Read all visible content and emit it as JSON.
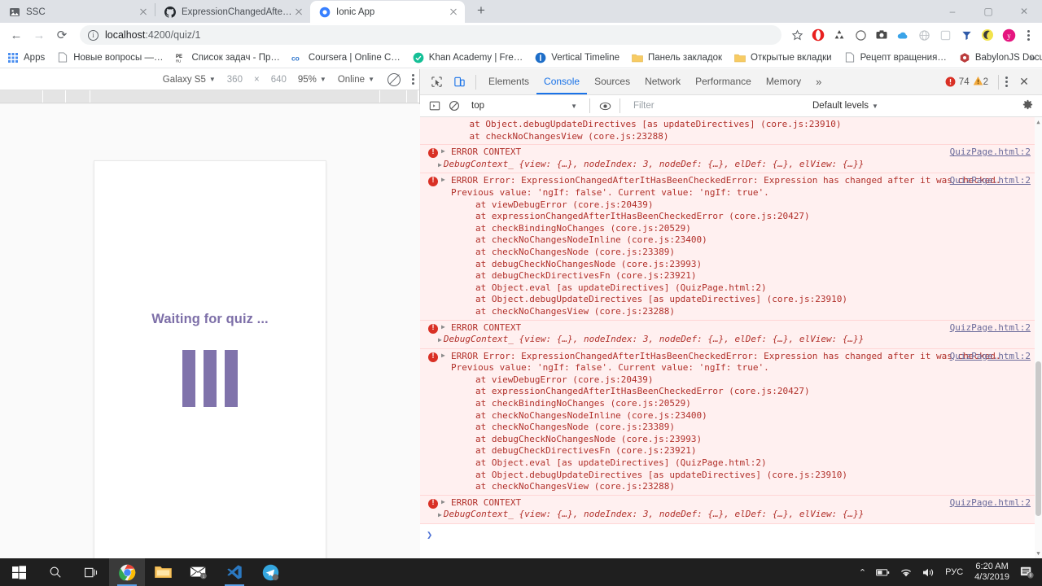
{
  "browser": {
    "tabs": [
      {
        "title": "SSC",
        "favicon": "image-icon",
        "active": false
      },
      {
        "title": "ExpressionChangedAfterItHasBe",
        "favicon": "github-icon",
        "active": false
      },
      {
        "title": "Ionic App",
        "favicon": "ionic-icon",
        "active": true
      }
    ],
    "new_tab_label": "+",
    "window_controls": {
      "minimize": "–",
      "maximize": "▢",
      "close": "✕"
    },
    "nav": {
      "back": "←",
      "forward": "→",
      "reload": "⟳"
    },
    "omnibox": {
      "info_glyph": "i",
      "url_host": "localhost",
      "url_path": ":4200/quiz/1",
      "star": "☆"
    },
    "extension_icons": [
      "opera-icon",
      "recycle-icon",
      "circle-icon",
      "camera-icon",
      "cloud-icon",
      "globe-icon",
      "frame-icon",
      "filter-icon",
      "moon-icon",
      "yandex-icon"
    ],
    "bookmarks": [
      {
        "label": "Apps",
        "icon": "apps-grid-icon"
      },
      {
        "label": "Новые вопросы —…",
        "icon": "page-icon"
      },
      {
        "label": "Список задач - Пр…",
        "icon": "pe-icon"
      },
      {
        "label": "Coursera | Online C…",
        "icon": "coursera-icon"
      },
      {
        "label": "Khan Academy | Fre…",
        "icon": "khan-icon"
      },
      {
        "label": "Vertical Timeline",
        "icon": "timeline-icon"
      },
      {
        "label": "Панель закладок",
        "icon": "folder-icon"
      },
      {
        "label": "Открытые вкладки",
        "icon": "folder-icon"
      },
      {
        "label": "Рецепт вращения…",
        "icon": "page-icon"
      },
      {
        "label": "BabylonJS Docume…",
        "icon": "babylon-icon"
      }
    ],
    "bookmarks_overflow": "»"
  },
  "devtools": {
    "emulation": {
      "device": "Galaxy S5",
      "width": "360",
      "height": "640",
      "multiply": "×",
      "zoom": "95%",
      "throttling": "Online",
      "rotate_icon": "rotate-icon",
      "more_icon": "kebab-icon"
    },
    "panel_tabs": [
      {
        "label": "Elements",
        "selected": false
      },
      {
        "label": "Console",
        "selected": true
      },
      {
        "label": "Sources",
        "selected": false
      },
      {
        "label": "Network",
        "selected": false
      },
      {
        "label": "Performance",
        "selected": false
      },
      {
        "label": "Memory",
        "selected": false
      }
    ],
    "more_tabs": "»",
    "error_count": "74",
    "warning_count": "2",
    "close_label": "✕",
    "console_toolbar": {
      "context": "top",
      "filter_placeholder": "Filter",
      "levels": "Default levels",
      "caret": "▾",
      "gear_icon": "gear-icon",
      "clear_icon": "clear-console-icon",
      "sidebar_icon": "console-sidebar-icon",
      "eye_icon": "live-expression-icon"
    },
    "prompt": "❯"
  },
  "device_page": {
    "waiting_text": "Waiting for quiz ...",
    "accent_color": "#8073ab",
    "text_color": "#7d6fa8",
    "spinner_bars": 3
  },
  "console_messages": [
    {
      "type": "stack-tail",
      "source": "",
      "lines": [
        "    at Object.debugUpdateDirectives [as updateDirectives] (core.js:23910)",
        "    at checkNoChangesView (core.js:23288)"
      ]
    },
    {
      "type": "error-context",
      "header": "ERROR CONTEXT",
      "source": "QuizPage.html:2",
      "context": "DebugContext_ {view: {…}, nodeIndex: 3, nodeDef: {…}, elDef: {…}, elView: {…}}"
    },
    {
      "type": "error",
      "source": "QuizPage.html:2",
      "header": "ERROR Error: ExpressionChangedAfterItHasBeenCheckedError: Expression has changed after it was checked. Previous value: 'ngIf: false'. Current value: 'ngIf: true'.",
      "stack": [
        "at viewDebugError (core.js:20439)",
        "at expressionChangedAfterItHasBeenCheckedError (core.js:20427)",
        "at checkBindingNoChanges (core.js:20529)",
        "at checkNoChangesNodeInline (core.js:23400)",
        "at checkNoChangesNode (core.js:23389)",
        "at debugCheckNoChangesNode (core.js:23993)",
        "at debugCheckDirectivesFn (core.js:23921)",
        "at Object.eval [as updateDirectives] (QuizPage.html:2)",
        "at Object.debugUpdateDirectives [as updateDirectives] (core.js:23910)",
        "at checkNoChangesView (core.js:23288)"
      ]
    },
    {
      "type": "error-context",
      "header": "ERROR CONTEXT",
      "source": "QuizPage.html:2",
      "context": "DebugContext_ {view: {…}, nodeIndex: 3, nodeDef: {…}, elDef: {…}, elView: {…}}"
    },
    {
      "type": "error",
      "source": "QuizPage.html:2",
      "header": "ERROR Error: ExpressionChangedAfterItHasBeenCheckedError: Expression has changed after it was checked. Previous value: 'ngIf: false'. Current value: 'ngIf: true'.",
      "stack": [
        "at viewDebugError (core.js:20439)",
        "at expressionChangedAfterItHasBeenCheckedError (core.js:20427)",
        "at checkBindingNoChanges (core.js:20529)",
        "at checkNoChangesNodeInline (core.js:23400)",
        "at checkNoChangesNode (core.js:23389)",
        "at debugCheckNoChangesNode (core.js:23993)",
        "at debugCheckDirectivesFn (core.js:23921)",
        "at Object.eval [as updateDirectives] (QuizPage.html:2)",
        "at Object.debugUpdateDirectives [as updateDirectives] (core.js:23910)",
        "at checkNoChangesView (core.js:23288)"
      ]
    },
    {
      "type": "error-context",
      "header": "ERROR CONTEXT",
      "source": "QuizPage.html:2",
      "context": "DebugContext_ {view: {…}, nodeIndex: 3, nodeDef: {…}, elDef: {…}, elView: {…}}"
    }
  ],
  "taskbar": {
    "start_icon": "windows-start-icon",
    "search_icon": "search-icon",
    "taskview_icon": "task-view-icon",
    "apps": [
      {
        "name": "chrome-icon",
        "state": "active"
      },
      {
        "name": "file-explorer-icon",
        "state": "idle"
      },
      {
        "name": "mail-icon",
        "state": "idle"
      },
      {
        "name": "vscode-icon",
        "state": "running"
      },
      {
        "name": "telegram-icon",
        "state": "idle"
      }
    ],
    "tray": {
      "chevron": "⌃",
      "battery_icon": "battery-icon",
      "wifi_icon": "wifi-icon",
      "volume_icon": "volume-icon",
      "language": "РУС",
      "time": "6:20 AM",
      "date": "4/3/2019",
      "notification_icon": "notifications-icon",
      "notification_count": "8"
    }
  }
}
